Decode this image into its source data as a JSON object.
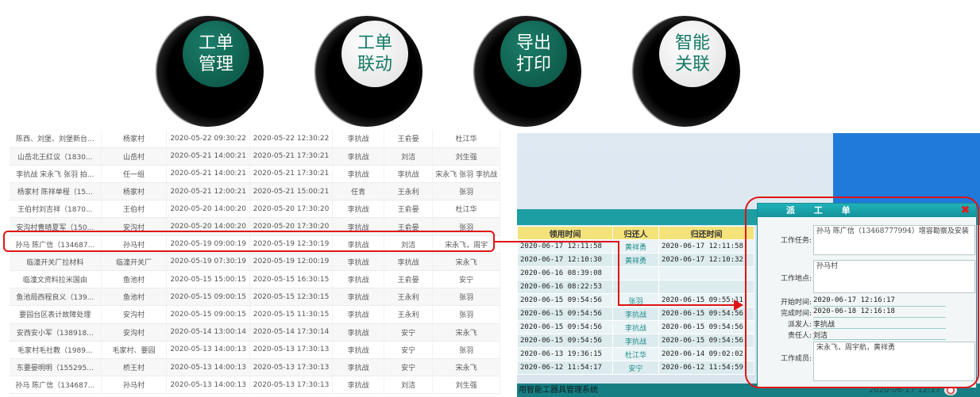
{
  "features": [
    {
      "line1": "工单",
      "line2": "管理",
      "style": "green"
    },
    {
      "line1": "工单",
      "line2": "联动",
      "style": "white"
    },
    {
      "line1": "导出",
      "line2": "打印",
      "style": "green"
    },
    {
      "line1": "智能",
      "line2": "关联",
      "style": "white"
    }
  ],
  "work_order_list": {
    "rows": [
      [
        "陈西、刘堡、刘堡新台...",
        "杨家村",
        "2020-05-22 09:30:22",
        "2020-05-22 12:30:22",
        "李抗战",
        "王俞晏",
        "杜江华"
      ],
      [
        "山岳北王红议（1830...",
        "山岳村",
        "2020-05-21 14:00:21",
        "2020-05-21 17:30:21",
        "李抗战",
        "刘洁",
        "刘生强"
      ],
      [
        "李抗战 宋永飞 张羽 拍...",
        "任一组",
        "2020-05-21 14:00:21",
        "2020-05-21 17:30:21",
        "李抗战",
        "李抗战",
        "宋永飞 张羽 李抗战"
      ],
      [
        "杨家村 陈祥单程（15...",
        "杨家村",
        "2020-05-21 12:00:21",
        "2020-05-21 15:00:21",
        "任青",
        "王永利",
        "张羽"
      ],
      [
        "王伯村刘吉祥（1870...",
        "王伯村",
        "2020-05-20 14:00:20",
        "2020-05-20 17:30:20",
        "李抗战",
        "王俞晏",
        "杜江华"
      ],
      [
        "安沟村曹晴夏军（150...",
        "安沟村",
        "2020-05-20 14:00:20",
        "2020-05-20 17:30:20",
        "李抗战",
        "王俞晏",
        "张羽"
      ],
      [
        "孙马 陈广信（134687...",
        "孙马村",
        "2020-05-19 09:00:19",
        "2020-05-19 12:30:19",
        "李抗战",
        "刘洁",
        "宋永飞，周宇"
      ],
      [
        "临潼开关厂拉材料",
        "临潼开关厂",
        "2020-05-19 07:30:19",
        "2020-05-19 12:00:19",
        "李抗战",
        "李抗战",
        "宋永飞"
      ],
      [
        "临潼文资料拉米国由",
        "鱼池村",
        "2020-05-15 15:00:15",
        "2020-05-15 16:30:15",
        "李抗战",
        "王俞晏",
        "安宁"
      ],
      [
        "鱼池局西程良义（139...",
        "鱼池村",
        "2020-05-15 09:00:15",
        "2020-05-15 12:30:15",
        "李抗战",
        "王永利",
        "张羽"
      ],
      [
        "要园台区表计故障处理",
        "安沟村",
        "2020-05-15 09:00:15",
        "2020-05-15 11:30:15",
        "李抗战",
        "王永利",
        "张羽"
      ],
      [
        "安西安小军（138918...",
        "安沟村",
        "2020-05-14 13:00:14",
        "2020-05-14 17:30:14",
        "李抗战",
        "安宁",
        "宋永飞"
      ],
      [
        "毛家村毛社教（1989...",
        "毛家村、要园",
        "2020-05-13 14:00:13",
        "2020-05-13 17:30:13",
        "李抗战",
        "安宁",
        "张羽"
      ],
      [
        "东要晏明明（155295...",
        "桥王村",
        "2020-05-13 14:00:13",
        "2020-05-13 17:30:13",
        "李抗战",
        "安宁",
        "宋永飞"
      ],
      [
        "孙马 陈广信（134687...",
        "孙马村",
        "2020-05-13 14:00:13",
        "2020-05-13 17:30:13",
        "李抗战",
        "刘洁",
        "刘生强"
      ]
    ]
  },
  "return_table": {
    "headers": [
      "领用时间",
      "归还人",
      "归还时间"
    ],
    "rows": [
      [
        "2020-06-17 12:11:58",
        "黄祥勇",
        "2020-06-17 12:11:58"
      ],
      [
        "2020-06-17 12:10:30",
        "黄祥勇",
        "2020-06-17 12:10:32"
      ],
      [
        "2020-06-16 08:39:08",
        "",
        ""
      ],
      [
        "2020-06-16 08:22:53",
        "",
        ""
      ],
      [
        "2020-06-15 09:54:56",
        "张羽",
        "2020-06-15 09:55:11"
      ],
      [
        "2020-06-15 09:54:56",
        "李抗战",
        "2020-06-15 09:54:56"
      ],
      [
        "2020-06-15 09:54:56",
        "李抗战",
        "2020-06-15 09:54:56"
      ],
      [
        "2020-06-15 09:54:56",
        "李抗战",
        "2020-06-15 09:54:56"
      ],
      [
        "2020-06-13 19:36:15",
        "杜江华",
        "2020-06-14 09:02:02"
      ],
      [
        "2020-06-12 11:54:17",
        "安宁",
        "2020-06-12 11:54:59"
      ]
    ]
  },
  "dispatch_dialog": {
    "title": "派 工 单",
    "close_glyph": "✖",
    "task_label": "工作任务:",
    "task_value": "孙马 陈广信（13468777994）增容勘察及安装",
    "location_label": "工作地点:",
    "location_value": "孙马村",
    "start_label": "开始时间:",
    "start_value": "2020-06-17 12:16:17",
    "finish_label": "完成时间:",
    "finish_value": "2020-06-18 12:16:18",
    "dispatcher_label": "派发人:",
    "dispatcher_value": "李抗战",
    "owner_label": "责任人:",
    "owner_value": "刘洁",
    "members_label": "工作成员:",
    "members_value": "宋永飞，周宇航，黄祥勇"
  },
  "status_bar": {
    "system_name": "用智能工器具管理系统",
    "clock": "2020-06-17 12:17"
  },
  "colors": {
    "accent_green": "#0f5e4d",
    "highlight_red": "#e01414",
    "teal": "#1c9ea3",
    "header_yellow": "#f4e27a"
  }
}
